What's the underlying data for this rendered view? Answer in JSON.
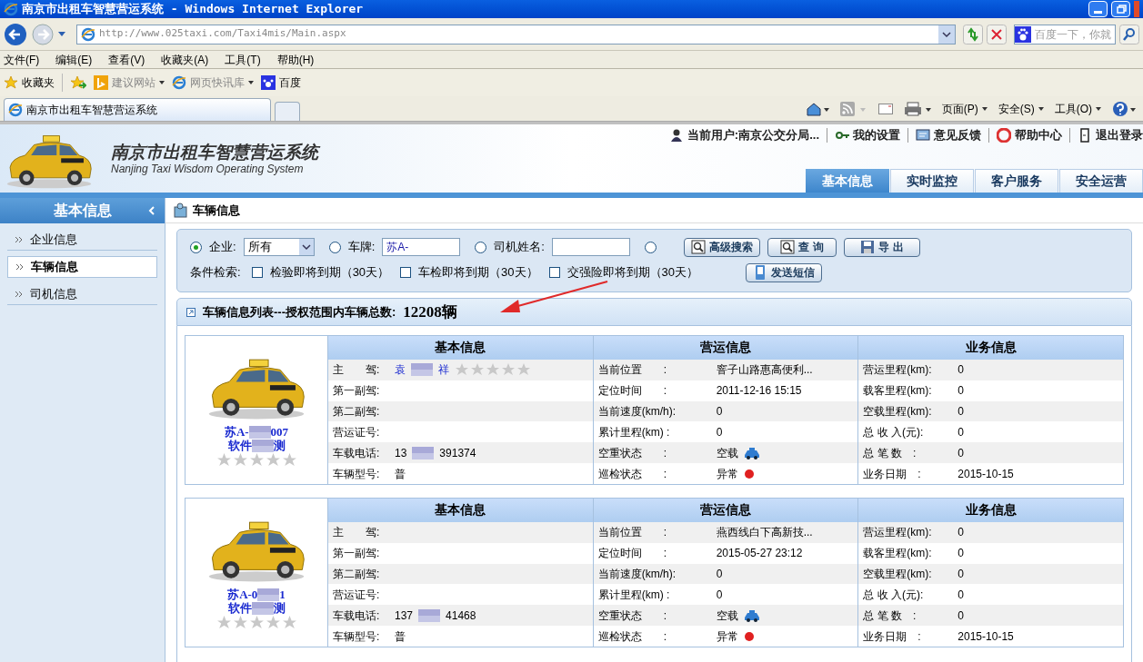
{
  "window": {
    "title": "南京市出租车智慧营运系统 - Windows Internet Explorer"
  },
  "address": {
    "url": "http://www.025taxi.com/Taxi4mis/Main.aspx",
    "search_placeholder": "百度一下，你就"
  },
  "menu": [
    "文件(F)",
    "编辑(E)",
    "查看(V)",
    "收藏夹(A)",
    "工具(T)",
    "帮助(H)"
  ],
  "favorites": {
    "label": "收藏夹",
    "links": [
      {
        "label": "建议网站",
        "kind": "bing"
      },
      {
        "label": "网页快讯库",
        "kind": "ie"
      },
      {
        "label": "百度",
        "kind": "baidu"
      }
    ]
  },
  "tab": {
    "title": "南京市出租车智慧营运系统"
  },
  "command_bar": [
    "页面(P)",
    "安全(S)",
    "工具(O)"
  ],
  "header": {
    "title": "南京市出租车智慧营运系统",
    "subtitle": "Nanjing Taxi Wisdom Operating System",
    "links": [
      {
        "label": "当前用户:南京公交分局...",
        "kind": "user"
      },
      {
        "label": "我的设置",
        "kind": "key"
      },
      {
        "label": "意见反馈",
        "kind": "feedback"
      },
      {
        "label": "帮助中心",
        "kind": "help"
      },
      {
        "label": "退出登录",
        "kind": "logout"
      }
    ],
    "nav": [
      {
        "label": "基本信息",
        "selected": true
      },
      {
        "label": "实时监控",
        "selected": false
      },
      {
        "label": "客户服务",
        "selected": false
      },
      {
        "label": "安全运营",
        "selected": false
      }
    ]
  },
  "sidebar": {
    "title": "基本信息",
    "items": [
      {
        "label": "企业信息",
        "selected": false
      },
      {
        "label": "车辆信息",
        "selected": true
      },
      {
        "label": "司机信息",
        "selected": false
      }
    ]
  },
  "breadcrumb": "车辆信息",
  "search": {
    "modes": [
      {
        "label": "企业:",
        "kind": "select",
        "value": "所有",
        "selected": true
      },
      {
        "label": "车牌:",
        "kind": "input",
        "value": "苏A-",
        "selected": false
      },
      {
        "label": "司机姓名:",
        "kind": "input",
        "selected": false
      },
      {
        "kind": "none",
        "selected": false
      }
    ],
    "buttons": [
      {
        "label": "高级搜索",
        "kind": "search"
      },
      {
        "label": "查 询",
        "kind": "search"
      },
      {
        "label": "导 出",
        "kind": "save"
      }
    ],
    "filter_label": "条件检索:",
    "filters": [
      {
        "label": "检验即将到期（30天）",
        "checked": false
      },
      {
        "label": "车检即将到期（30天）",
        "checked": false
      },
      {
        "label": "交强险即将到期（30天）",
        "checked": false
      }
    ],
    "sms_button": "发送短信"
  },
  "list": {
    "title": "车辆信息列表---授权范围内车辆总数:",
    "count": "12208辆"
  },
  "cards": [
    {
      "plate": [
        "苏A-",
        "007"
      ],
      "name": [
        "软件",
        "测"
      ],
      "stars": 0,
      "sections": [
        {
          "title": "基本信息",
          "rows": [
            {
              "label": "主　　驾:",
              "value": [
                "袁",
                "祥"
              ],
              "kind": "driver",
              "stars": 0
            },
            {
              "label": "第一副驾:",
              "value": []
            },
            {
              "label": "第二副驾:",
              "value": []
            },
            {
              "label": "营运证号:",
              "value": []
            },
            {
              "label": "车载电话:",
              "value": [
                "13",
                "391374"
              ]
            },
            {
              "label": "车辆型号:",
              "value": [
                "普"
              ]
            }
          ]
        },
        {
          "title": "营运信息",
          "rows": [
            {
              "label": "当前位置　　:",
              "value": [
                "窨子山路惠高便利..."
              ]
            },
            {
              "label": "定位时间　　:",
              "value": [
                "2011-12-16 15:15"
              ]
            },
            {
              "label": "当前速度(km/h):",
              "value": [
                "0"
              ]
            },
            {
              "label": "累计里程(km) :",
              "value": [
                "0"
              ]
            },
            {
              "label": "空重状态　　:",
              "value": [
                "空载"
              ],
              "kind": "car"
            },
            {
              "label": "巡检状态　　:",
              "value": [
                "异常"
              ],
              "kind": "alert"
            }
          ]
        },
        {
          "title": "业务信息",
          "rows": [
            {
              "label": "营运里程(km):",
              "value": [
                "0"
              ]
            },
            {
              "label": "载客里程(km):",
              "value": [
                "0"
              ]
            },
            {
              "label": "空载里程(km):",
              "value": [
                "0"
              ]
            },
            {
              "label": "总 收 入(元):",
              "value": [
                "0"
              ]
            },
            {
              "label": "总 笔 数　:",
              "value": [
                "0"
              ]
            },
            {
              "label": "业务日期　:",
              "value": [
                "2015-10-15"
              ]
            }
          ]
        }
      ]
    },
    {
      "plate": [
        "苏A-0",
        "1"
      ],
      "name": [
        "软件",
        "测"
      ],
      "stars": 0,
      "sections": [
        {
          "title": "基本信息",
          "rows": [
            {
              "label": "主　　驾:",
              "value": []
            },
            {
              "label": "第一副驾:",
              "value": []
            },
            {
              "label": "第二副驾:",
              "value": []
            },
            {
              "label": "营运证号:",
              "value": []
            },
            {
              "label": "车载电话:",
              "value": [
                "137",
                "41468"
              ]
            },
            {
              "label": "车辆型号:",
              "value": [
                "普"
              ]
            }
          ]
        },
        {
          "title": "营运信息",
          "rows": [
            {
              "label": "当前位置　　:",
              "value": [
                "燕西线白下高新技..."
              ]
            },
            {
              "label": "定位时间　　:",
              "value": [
                "2015-05-27 23:12"
              ]
            },
            {
              "label": "当前速度(km/h):",
              "value": [
                "0"
              ]
            },
            {
              "label": "累计里程(km) :",
              "value": [
                "0"
              ]
            },
            {
              "label": "空重状态　　:",
              "value": [
                "空载"
              ],
              "kind": "car"
            },
            {
              "label": "巡检状态　　:",
              "value": [
                "异常"
              ],
              "kind": "alert"
            }
          ]
        },
        {
          "title": "业务信息",
          "rows": [
            {
              "label": "营运里程(km):",
              "value": [
                "0"
              ]
            },
            {
              "label": "载客里程(km):",
              "value": [
                "0"
              ]
            },
            {
              "label": "空载里程(km):",
              "value": [
                "0"
              ]
            },
            {
              "label": "总 收 入(元):",
              "value": [
                "0"
              ]
            },
            {
              "label": "总 笔 数　:",
              "value": [
                "0"
              ]
            },
            {
              "label": "业务日期　:",
              "value": [
                "2015-10-15"
              ]
            }
          ]
        }
      ]
    }
  ]
}
